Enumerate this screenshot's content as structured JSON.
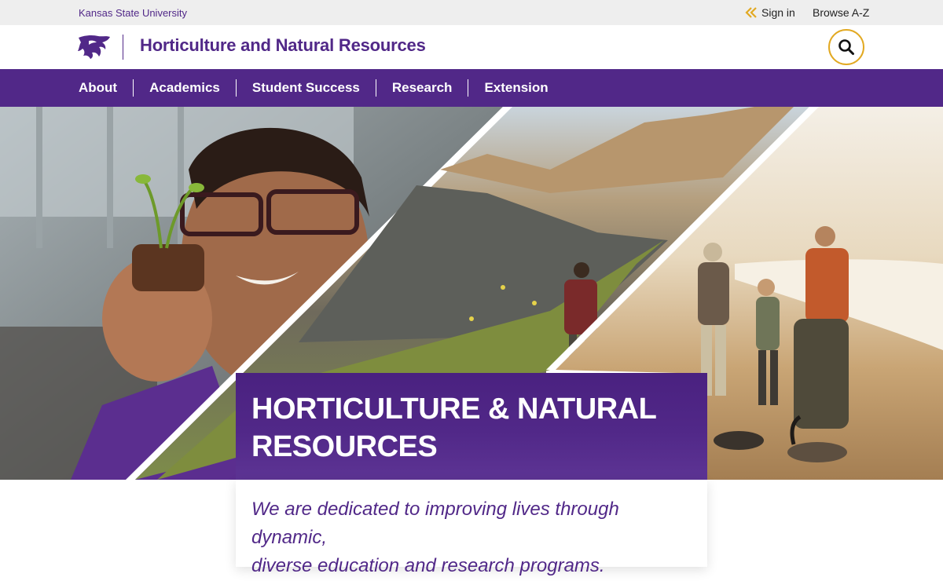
{
  "utility": {
    "university": "Kansas State University",
    "sign_in": "Sign in",
    "browse": "Browse A-Z"
  },
  "header": {
    "logo_icon": "powercat-logo-icon",
    "site_title": "Horticulture and Natural Resources",
    "search_icon": "search-icon"
  },
  "nav": {
    "items": [
      {
        "label": "About"
      },
      {
        "label": "Academics"
      },
      {
        "label": "Student Success"
      },
      {
        "label": "Research"
      },
      {
        "label": "Extension"
      }
    ]
  },
  "hero": {
    "title_line1": "HORTICULTURE & NATURAL",
    "title_line2": "RESOURCES",
    "tagline_line1": "We are dedicated to improving lives through dynamic,",
    "tagline_line2": "diverse education and research programs."
  },
  "colors": {
    "brand_purple": "#512888",
    "accent_gold": "#e2a922",
    "utility_gray": "#eeeeee"
  }
}
